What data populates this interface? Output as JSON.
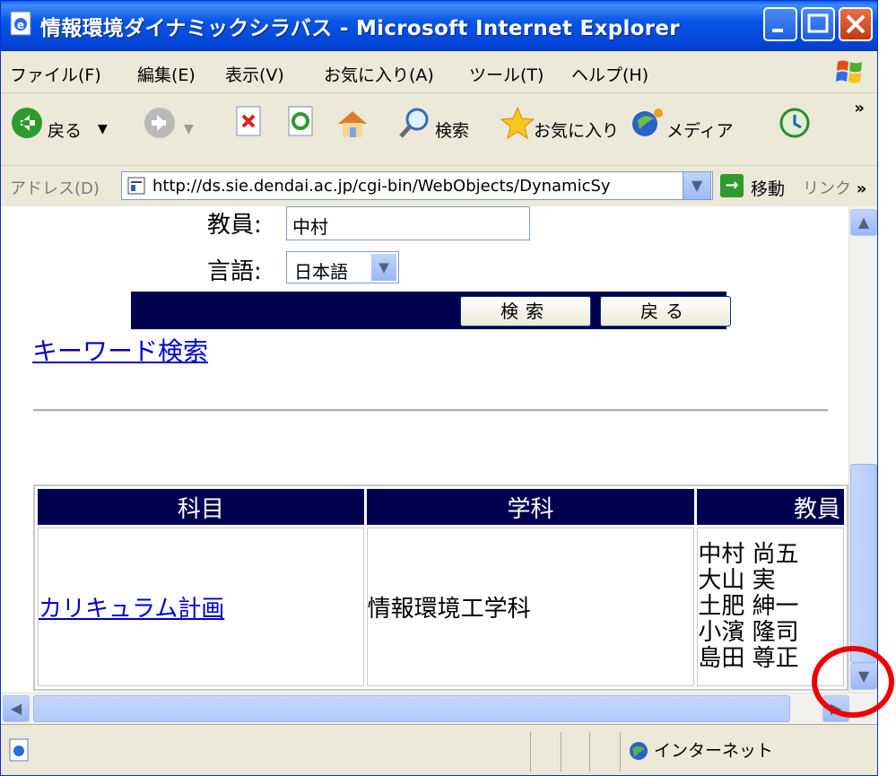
{
  "window": {
    "title": "情報環境ダイナミックシラバス - Microsoft Internet Explorer"
  },
  "menu": [
    "ファイル(F)",
    "編集(E)",
    "表示(V)",
    "お気に入り(A)",
    "ツール(T)",
    "ヘルプ(H)"
  ],
  "toolbar": {
    "back": "戻る",
    "search": "検索",
    "favorites": "お気に入り",
    "media": "メディア"
  },
  "address": {
    "label": "アドレス(D)",
    "url": "http://ds.sie.dendai.ac.jp/cgi-bin/WebObjects/DynamicSy",
    "go": "移動",
    "links": "リンク"
  },
  "form": {
    "teacher_label": "教員:",
    "teacher_value": "中村",
    "language_label": "言語:",
    "language_value": "日本語",
    "search_button": "検索",
    "back_button": "戻る"
  },
  "keyword_link": "キーワード検索",
  "results": {
    "headers": [
      "科目",
      "学科",
      "教員"
    ],
    "rows": [
      {
        "subject": "カリキュラム計画",
        "department": "情報環境工学科",
        "teachers": [
          "中村 尚五",
          "大山 実",
          "土肥 紳一",
          "小濱 隆司",
          "島田 尊正"
        ]
      }
    ]
  },
  "status": {
    "zone": "インターネット"
  },
  "colors": {
    "title_bar": "#0a56e6",
    "table_header": "#000050",
    "link": "#0000cc",
    "highlight_circle": "#ee0000"
  }
}
